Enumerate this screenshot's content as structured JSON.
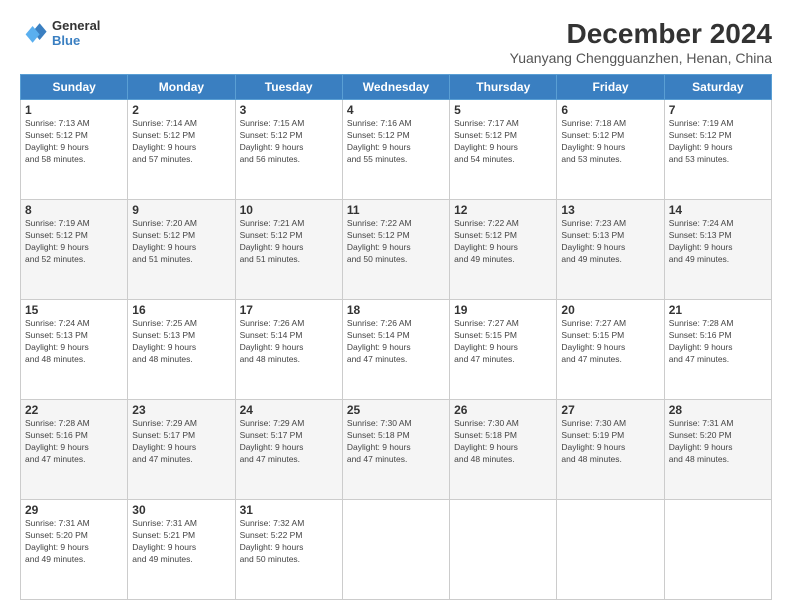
{
  "header": {
    "logo_line1": "General",
    "logo_line2": "Blue",
    "main_title": "December 2024",
    "subtitle": "Yuanyang Chengguanzhen, Henan, China"
  },
  "weekdays": [
    "Sunday",
    "Monday",
    "Tuesday",
    "Wednesday",
    "Thursday",
    "Friday",
    "Saturday"
  ],
  "weeks": [
    [
      {
        "day": "1",
        "info": "Sunrise: 7:13 AM\nSunset: 5:12 PM\nDaylight: 9 hours\nand 58 minutes."
      },
      {
        "day": "2",
        "info": "Sunrise: 7:14 AM\nSunset: 5:12 PM\nDaylight: 9 hours\nand 57 minutes."
      },
      {
        "day": "3",
        "info": "Sunrise: 7:15 AM\nSunset: 5:12 PM\nDaylight: 9 hours\nand 56 minutes."
      },
      {
        "day": "4",
        "info": "Sunrise: 7:16 AM\nSunset: 5:12 PM\nDaylight: 9 hours\nand 55 minutes."
      },
      {
        "day": "5",
        "info": "Sunrise: 7:17 AM\nSunset: 5:12 PM\nDaylight: 9 hours\nand 54 minutes."
      },
      {
        "day": "6",
        "info": "Sunrise: 7:18 AM\nSunset: 5:12 PM\nDaylight: 9 hours\nand 53 minutes."
      },
      {
        "day": "7",
        "info": "Sunrise: 7:19 AM\nSunset: 5:12 PM\nDaylight: 9 hours\nand 53 minutes."
      }
    ],
    [
      {
        "day": "8",
        "info": "Sunrise: 7:19 AM\nSunset: 5:12 PM\nDaylight: 9 hours\nand 52 minutes."
      },
      {
        "day": "9",
        "info": "Sunrise: 7:20 AM\nSunset: 5:12 PM\nDaylight: 9 hours\nand 51 minutes."
      },
      {
        "day": "10",
        "info": "Sunrise: 7:21 AM\nSunset: 5:12 PM\nDaylight: 9 hours\nand 51 minutes."
      },
      {
        "day": "11",
        "info": "Sunrise: 7:22 AM\nSunset: 5:12 PM\nDaylight: 9 hours\nand 50 minutes."
      },
      {
        "day": "12",
        "info": "Sunrise: 7:22 AM\nSunset: 5:12 PM\nDaylight: 9 hours\nand 49 minutes."
      },
      {
        "day": "13",
        "info": "Sunrise: 7:23 AM\nSunset: 5:13 PM\nDaylight: 9 hours\nand 49 minutes."
      },
      {
        "day": "14",
        "info": "Sunrise: 7:24 AM\nSunset: 5:13 PM\nDaylight: 9 hours\nand 49 minutes."
      }
    ],
    [
      {
        "day": "15",
        "info": "Sunrise: 7:24 AM\nSunset: 5:13 PM\nDaylight: 9 hours\nand 48 minutes."
      },
      {
        "day": "16",
        "info": "Sunrise: 7:25 AM\nSunset: 5:13 PM\nDaylight: 9 hours\nand 48 minutes."
      },
      {
        "day": "17",
        "info": "Sunrise: 7:26 AM\nSunset: 5:14 PM\nDaylight: 9 hours\nand 48 minutes."
      },
      {
        "day": "18",
        "info": "Sunrise: 7:26 AM\nSunset: 5:14 PM\nDaylight: 9 hours\nand 47 minutes."
      },
      {
        "day": "19",
        "info": "Sunrise: 7:27 AM\nSunset: 5:15 PM\nDaylight: 9 hours\nand 47 minutes."
      },
      {
        "day": "20",
        "info": "Sunrise: 7:27 AM\nSunset: 5:15 PM\nDaylight: 9 hours\nand 47 minutes."
      },
      {
        "day": "21",
        "info": "Sunrise: 7:28 AM\nSunset: 5:16 PM\nDaylight: 9 hours\nand 47 minutes."
      }
    ],
    [
      {
        "day": "22",
        "info": "Sunrise: 7:28 AM\nSunset: 5:16 PM\nDaylight: 9 hours\nand 47 minutes."
      },
      {
        "day": "23",
        "info": "Sunrise: 7:29 AM\nSunset: 5:17 PM\nDaylight: 9 hours\nand 47 minutes."
      },
      {
        "day": "24",
        "info": "Sunrise: 7:29 AM\nSunset: 5:17 PM\nDaylight: 9 hours\nand 47 minutes."
      },
      {
        "day": "25",
        "info": "Sunrise: 7:30 AM\nSunset: 5:18 PM\nDaylight: 9 hours\nand 47 minutes."
      },
      {
        "day": "26",
        "info": "Sunrise: 7:30 AM\nSunset: 5:18 PM\nDaylight: 9 hours\nand 48 minutes."
      },
      {
        "day": "27",
        "info": "Sunrise: 7:30 AM\nSunset: 5:19 PM\nDaylight: 9 hours\nand 48 minutes."
      },
      {
        "day": "28",
        "info": "Sunrise: 7:31 AM\nSunset: 5:20 PM\nDaylight: 9 hours\nand 48 minutes."
      }
    ],
    [
      {
        "day": "29",
        "info": "Sunrise: 7:31 AM\nSunset: 5:20 PM\nDaylight: 9 hours\nand 49 minutes."
      },
      {
        "day": "30",
        "info": "Sunrise: 7:31 AM\nSunset: 5:21 PM\nDaylight: 9 hours\nand 49 minutes."
      },
      {
        "day": "31",
        "info": "Sunrise: 7:32 AM\nSunset: 5:22 PM\nDaylight: 9 hours\nand 50 minutes."
      },
      null,
      null,
      null,
      null
    ]
  ]
}
